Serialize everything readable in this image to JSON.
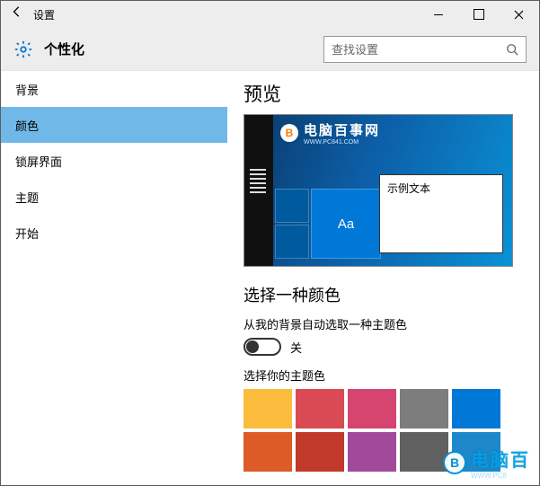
{
  "window": {
    "title": "设置"
  },
  "header": {
    "title": "个性化",
    "search_placeholder": "查找设置"
  },
  "sidebar": {
    "items": [
      {
        "label": "背景",
        "selected": false
      },
      {
        "label": "颜色",
        "selected": true
      },
      {
        "label": "锁屏界面",
        "selected": false
      },
      {
        "label": "主题",
        "selected": false
      },
      {
        "label": "开始",
        "selected": false
      }
    ]
  },
  "main": {
    "preview_heading": "预览",
    "preview": {
      "watermark_text": "电脑百事网",
      "watermark_sub": "WWW.PC841.COM",
      "sample_text": "示例文本",
      "tile_aa": "Aa"
    },
    "choose_color_heading": "选择一种颜色",
    "auto_pick_label": "从我的背景自动选取一种主题色",
    "toggle_state": "关",
    "accent_label": "选择你的主题色",
    "swatches_row1": [
      "#fbbc3d",
      "#d94a54",
      "#d6456f",
      "#7d7d7d",
      "#0078d7"
    ],
    "swatches_row2": [
      "#dc5b26",
      "#c0392b",
      "#a14a9b",
      "#606060",
      "#1c87c9"
    ]
  },
  "watermark_bottom": {
    "text": "电脑百",
    "sub": "WWW.PC8"
  }
}
